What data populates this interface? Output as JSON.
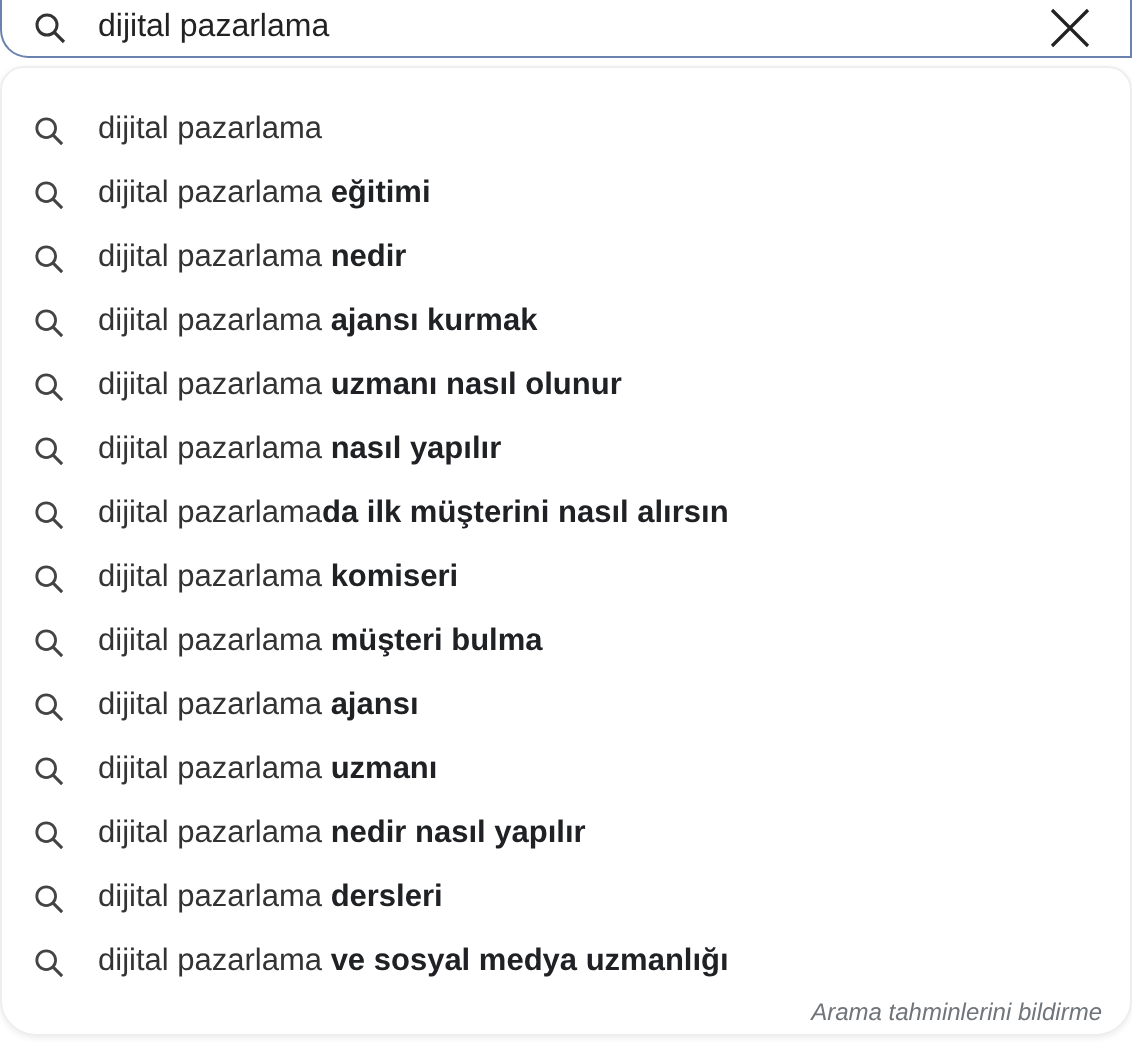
{
  "search": {
    "value": "dijital pazarlama"
  },
  "suggestions": [
    {
      "text": "dijital pazarlama"
    },
    {
      "text": "dijital pazarlama **eğitimi**"
    },
    {
      "text": "dijital pazarlama **nedir**"
    },
    {
      "text": "dijital pazarlama **ajansı kurmak**"
    },
    {
      "text": "dijital pazarlama **uzmanı nasıl olunur**"
    },
    {
      "text": "dijital pazarlama **nasıl yapılır**"
    },
    {
      "text": "dijital pazarlama**da ilk müşterini nasıl alırsın**"
    },
    {
      "text": "dijital pazarlama **komiseri**"
    },
    {
      "text": "dijital pazarlama **müşteri bulma**"
    },
    {
      "text": "dijital pazarlama **ajansı**"
    },
    {
      "text": "dijital pazarlama **uzmanı**"
    },
    {
      "text": "dijital pazarlama **nedir nasıl yapılır**"
    },
    {
      "text": "dijital pazarlama **dersleri**"
    },
    {
      "text": "dijital pazarlama **ve sosyal medya uzmanlığı**"
    }
  ],
  "footer_link": "Arama tahminlerini bildirme"
}
